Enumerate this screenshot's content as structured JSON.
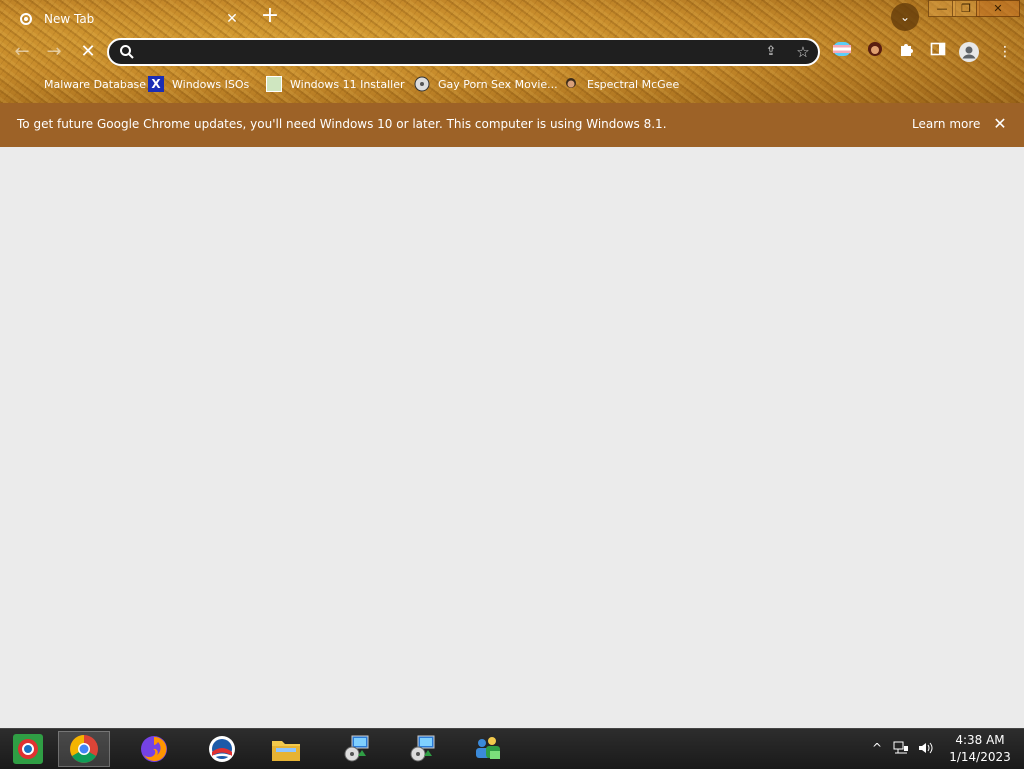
{
  "browser": {
    "tab": {
      "title": "New Tab",
      "close_glyph": "✕"
    },
    "new_tab_glyph": "+",
    "tab_search_glyph": "⌄",
    "window_controls": {
      "minimize": "—",
      "restore": "❐",
      "close": "✕"
    },
    "nav": {
      "back": "←",
      "forward": "→",
      "stop": "✕"
    },
    "omnibox": {
      "value": "",
      "placeholder": ""
    },
    "bookmarks": [
      {
        "label": "Malware Database",
        "icon": "blank-page-icon"
      },
      {
        "label": "Windows ISOs",
        "icon": "x-logo-icon"
      },
      {
        "label": "Windows 11 Installer",
        "icon": "image-icon"
      },
      {
        "label": "Gay Porn Sex Movie...",
        "icon": "cd-icon"
      },
      {
        "label": "Espectral McGee",
        "icon": "avatar-icon"
      }
    ],
    "infobar": {
      "message": "To get future Google Chrome updates, you'll need Windows 10 or later. This computer is using Windows 8.1.",
      "learn_more": "Learn more",
      "close_glyph": "✕"
    }
  },
  "taskbar": {
    "apps": [
      "start-button",
      "chrome",
      "firefox",
      "obama-logo-app",
      "file-explorer",
      "installer-1",
      "installer-2",
      "network-app"
    ],
    "tray_chevron": "^",
    "clock": {
      "time": "4:38 AM",
      "date": "1/14/2023"
    }
  },
  "colors": {
    "frame": "#c5892a",
    "infobar": "#9d6227",
    "content": "#ebebeb",
    "taskbar": "#1f1f1f"
  }
}
